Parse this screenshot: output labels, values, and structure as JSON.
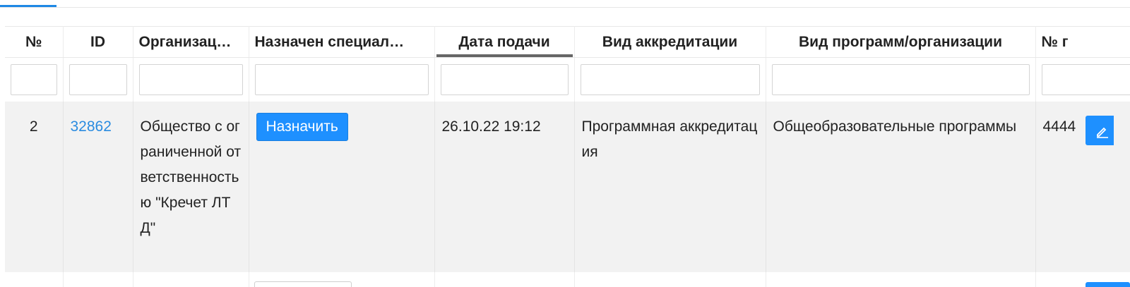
{
  "table": {
    "columns": [
      {
        "label": "№"
      },
      {
        "label": "ID"
      },
      {
        "label": "Организац…"
      },
      {
        "label": "Назначен специал…"
      },
      {
        "label": "Дата подачи"
      },
      {
        "label": "Вид аккредитации"
      },
      {
        "label": "Вид программ/организации"
      },
      {
        "label": "№ г"
      }
    ],
    "rows": [
      {
        "num": "2",
        "id": "32862",
        "organization": "Общество с ограниченной ответственностью \"Кречет ЛТД\"",
        "assign_button": "Назначить",
        "date": "26.10.22 19:12",
        "accreditation_type": "Программная аккредитация",
        "program_type": "Общеобразовательные программы",
        "number": "4444"
      }
    ]
  },
  "icons": {
    "edit": "pencil-icon"
  },
  "colors": {
    "accent": "#1e90ff",
    "link": "#2a8be0",
    "row_background": "#f2f2f2",
    "sort_indicator": "#666666"
  }
}
